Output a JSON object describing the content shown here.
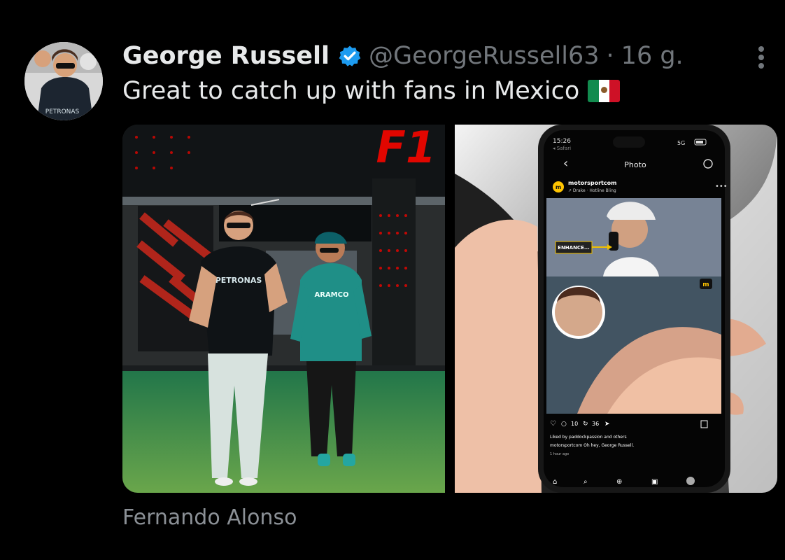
{
  "author": {
    "name": "George Russell",
    "handle": "@GeorgeRussell63",
    "time": "16 g.",
    "avatar_text": "PETRONAS"
  },
  "post": {
    "text": "Great to catch up with fans in Mexico",
    "flag_icon": "mexico-flag-icon",
    "dot": "·"
  },
  "media": {
    "left": {
      "brand_logo": "F1",
      "left_driver_shirt": "PETRONAS",
      "right_driver_shirt": "ARAMCO"
    },
    "right": {
      "phone": {
        "status_time": "15:26",
        "status_back": "◂ Safari",
        "status_signal": "5G",
        "title": "Photo",
        "account": "motorsportcom",
        "audio": "↗ Drake · Hotline Bling",
        "enhance_label": "ENHANCE...",
        "likes": "10",
        "reposts": "36",
        "liked_by": "Liked by paddockpassion and others",
        "comment": "motorsportcom Oh hey, George Russell.",
        "age": "1 hour ago"
      }
    }
  },
  "caption": "Fernando Alonso",
  "colors": {
    "verified": "#1d9bf0",
    "accent_red": "#e10600",
    "teal": "#1f8f87"
  }
}
